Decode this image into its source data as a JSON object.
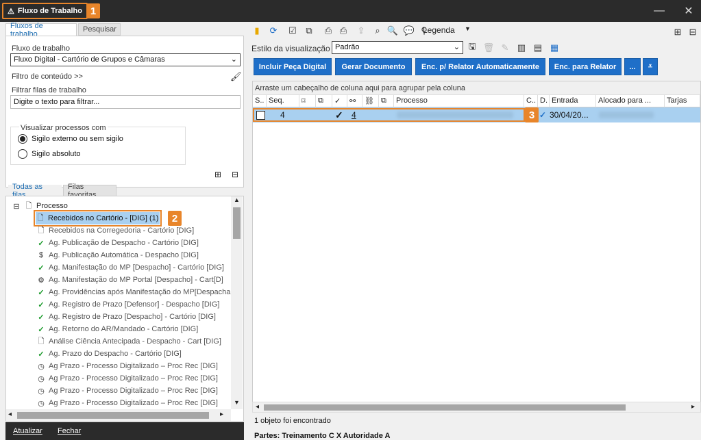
{
  "window": {
    "title": "Fluxo de Trabalho",
    "minimize": "—",
    "close": "✕"
  },
  "badges": {
    "b1": "1",
    "b2": "2",
    "b3": "3"
  },
  "left": {
    "tabs": [
      "Fluxos de trabalho",
      "Pesquisar"
    ],
    "workflow_label": "Fluxo de trabalho",
    "workflow_value": "Fluxo Digital - Cartório de Grupos e Câmaras",
    "content_filter": "Filtro de conteúdo >>",
    "queue_filter_label": "Filtrar filas de trabalho",
    "queue_filter_placeholder": "Digite o texto para filtrar...",
    "view_group_title": "Visualizar processos com",
    "radio_external": "Sigilo externo ou sem sigilo",
    "radio_absolute": "Sigilo absoluto",
    "queue_tabs": [
      "Todas as filas",
      "Filas favoritas"
    ],
    "tree_root": "Processo",
    "tree_items": [
      "Recebidos no Cartório - [DIG] (1)",
      "Recebidos na Corregedoria - Cartório [DIG]",
      "Ag. Publicação de Despacho - Cartório [DIG]",
      "Ag. Publicação Automática - Despacho [DIG]",
      "Ag. Manifestação do MP [Despacho] - Cartório [DIG]",
      "Ag. Manifestação do MP Portal [Despacho] - Cart[D]",
      "Ag. Providências após Manifestação do MP[Despacha",
      "Ag. Registro de Prazo [Defensor] - Despacho [DIG]",
      "Ag. Registro de Prazo [Despacho] - Cartório [DIG]",
      "Ag. Retorno do AR/Mandado - Cartório [DIG]",
      "Análise Ciência Antecipada - Despacho - Cart [DIG]",
      "Ag. Prazo do Despacho - Cartório [DIG]",
      "Ag Prazo - Processo Digitalizado – Proc Rec [DIG]",
      "Ag Prazo - Processo Digitalizado – Proc Rec [DIG]",
      "Ag Prazo - Processo Digitalizado – Proc Rec [DIG]",
      "Ag Prazo - Processo Digitalizado – Proc Rec [DIG]"
    ],
    "refresh": "Atualizar",
    "close": "Fechar"
  },
  "right": {
    "legend": "Legenda",
    "view_style_label": "Estilo da visualização",
    "view_style_value": "Padrão",
    "buttons": [
      "Incluir Peça Digital",
      "Gerar Documento",
      "Enc. p/ Relator Automaticamente",
      "Enc. para Relator",
      "..."
    ],
    "group_hint": "Arraste um cabeçalho de coluna aqui para agrupar pela coluna",
    "columns": [
      "S..",
      "Seq.",
      "C..",
      "D.",
      "Entrada",
      "Alocado para ...",
      "Tarjas",
      "Processo"
    ],
    "row": {
      "seq": "4",
      "count": "4",
      "date": "30/04/20..."
    },
    "status": "1 objeto foi encontrado",
    "parts": "Partes: Treinamento C  X  Autoridade A"
  }
}
